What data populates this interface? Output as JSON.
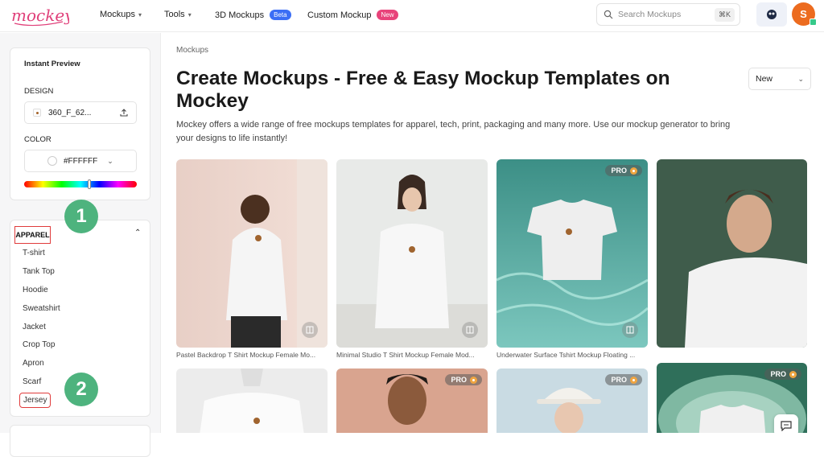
{
  "brand": {
    "name": "mockey",
    "color": "#e0407a"
  },
  "nav": {
    "mockups": "Mockups",
    "tools": "Tools",
    "three_d": "3D Mockups",
    "three_d_badge": "Beta",
    "custom": "Custom Mockup",
    "custom_badge": "New"
  },
  "search": {
    "placeholder": "Search Mockups",
    "shortcut": "⌘K"
  },
  "user": {
    "initial": "S"
  },
  "sidebar": {
    "preview_title": "Instant Preview",
    "design_label": "DESIGN",
    "design_file": "360_F_62...",
    "color_label": "COLOR",
    "color_value": "#FFFFFF",
    "category": "APPAREL",
    "items": [
      "T-shirt",
      "Tank Top",
      "Hoodie",
      "Sweatshirt",
      "Jacket",
      "Crop Top",
      "Apron",
      "Scarf",
      "Jersey"
    ]
  },
  "annotations": [
    "1",
    "2"
  ],
  "main": {
    "breadcrumb": "Mockups",
    "title": "Create Mockups - Free & Easy Mockup Templates on Mockey",
    "sort": "New",
    "description": "Mockey offers a wide range of free mockups templates for apparel, tech, print, packaging and many more. Use our mockup generator to bring your designs to life instantly!",
    "pro_label": "PRO",
    "cards": [
      {
        "caption": "Pastel Backdrop T Shirt Mockup Female Mo..."
      },
      {
        "caption": "Minimal Studio T Shirt Mockup Female Mod..."
      },
      {
        "caption": "Underwater Surface Tshirt Mockup Floating ..."
      },
      {
        "caption": ""
      }
    ]
  },
  "colors": {
    "accent": "#3b6ef5",
    "new_badge": "#e8437a",
    "highlight": "#e03b3b",
    "step": "#4eb37e"
  }
}
